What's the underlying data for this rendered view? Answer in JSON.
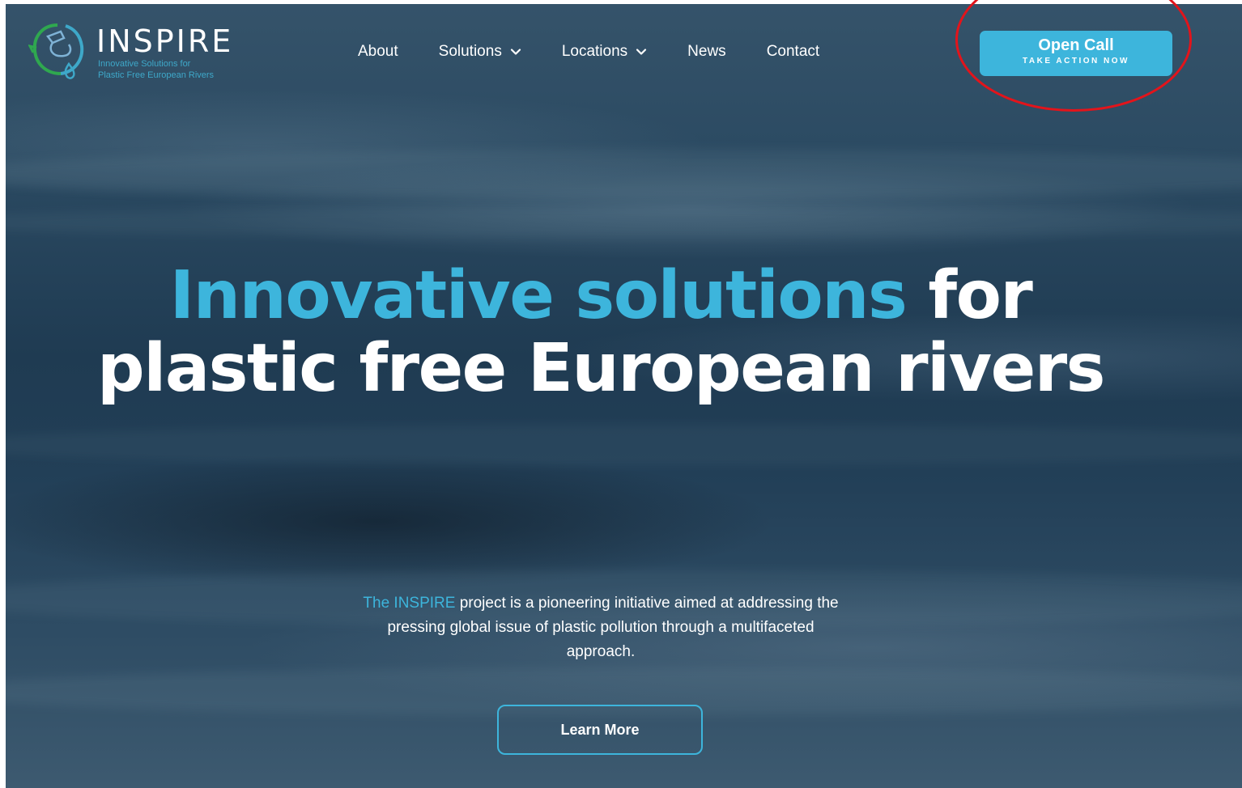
{
  "logo": {
    "wordmark": "INSPIRE",
    "tagline_line1": "Innovative Solutions for",
    "tagline_line2": "Plastic Free European Rivers",
    "icon": "river-tap-drop-icon"
  },
  "nav": {
    "items": [
      {
        "label": "About",
        "has_dropdown": false
      },
      {
        "label": "Solutions",
        "has_dropdown": true
      },
      {
        "label": "Locations",
        "has_dropdown": true
      },
      {
        "label": "News",
        "has_dropdown": false
      },
      {
        "label": "Contact",
        "has_dropdown": false
      }
    ],
    "dropdown_icon": "chevron-down-icon"
  },
  "cta": {
    "title": "Open Call",
    "subtitle": "TAKE ACTION NOW"
  },
  "hero": {
    "headline_accent": "Innovative solutions",
    "headline_rest_line1": " for",
    "headline_line2": "plastic free European rivers",
    "intro_accent": "The INSPIRE",
    "intro_rest": " project is a pioneering initiative aimed at addressing the pressing global issue of plastic pollution through a multifaceted approach.",
    "learn_more_label": "Learn More"
  },
  "colors": {
    "accent": "#3db5dc",
    "annotation": "#e3141b",
    "text": "#ffffff",
    "background": "#2b4a62"
  }
}
